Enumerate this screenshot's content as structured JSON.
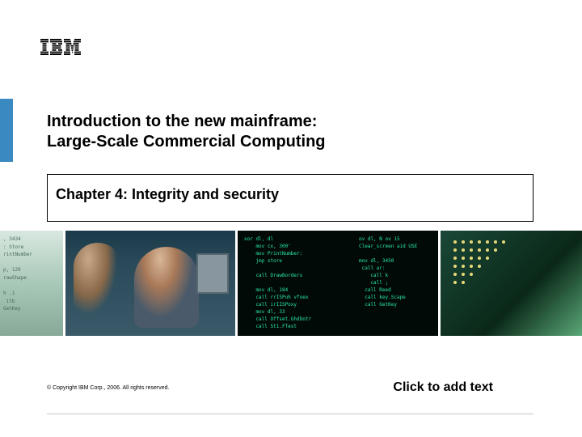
{
  "title": {
    "line1": "Introduction to the new mainframe:",
    "line2": "Large-Scale Commercial Computing"
  },
  "chapter": "Chapter 4: Integrity and security",
  "copyright": "© Copyright IBM Corp., 2006. All rights reserved.",
  "placeholder": "Click to add text",
  "code_panel_left": ", 3434\n: Store\nrintNumber\n\np, 129\nrawShape\n\nh .1\n itb\nGetKey",
  "code_panel_center": "xor dl, dl\n    mov cx, 300'\n    mov PrintNumber:\n    jmp store\n\n    call DrawBorders\n\n    mov dl, 184\n    call rrISPuh vfoex\n    call irIISPoxy\n    mov dl, 33\n    call Offset.GhdDotr\n    call St1.FTest",
  "code_panel_right": "ov dl, N ov 15\nClear_screen aid USE\n\nmov dl, 3450\n call ar:\n    call k\n    call ;\n  call Reed\n  call key.Scape\n  call GetKey"
}
